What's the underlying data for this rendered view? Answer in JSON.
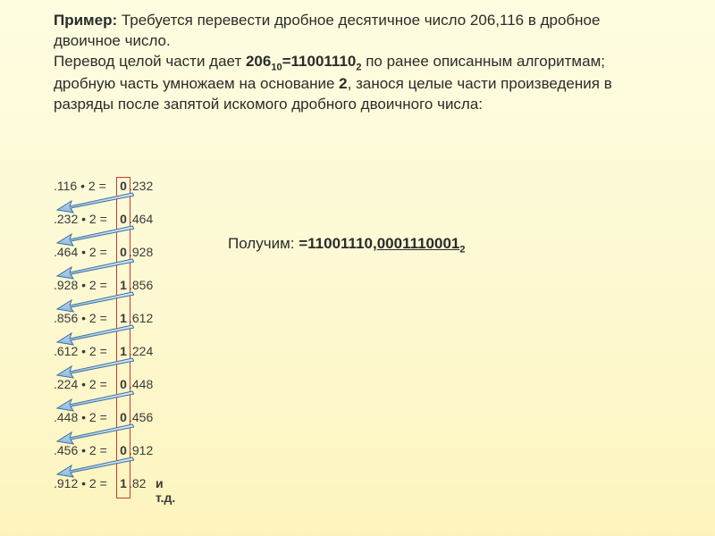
{
  "title": {
    "label_primer": "Пример:",
    "line1_rest": " Требуется перевести дробное десятичное число 206,116 в дробное двоичное число.",
    "line2a": "Перевод целой части дает ",
    "int_dec": "206",
    "int_dec_base": "10",
    "eq": "=",
    "int_bin": "11001110",
    "int_bin_base": "2",
    "line2b": " по ранее описанным алгоритмам; дробную часть умножаем на основание ",
    "base2": "2",
    "line2c": ", занося целые части произведения в разряды после запятой искомого дробного двоичного числа:"
  },
  "calc": [
    {
      "lhs": ".116 • 2 = ",
      "d": "0",
      "rhs": ".232"
    },
    {
      "lhs": ".232 • 2 = ",
      "d": "0",
      "rhs": ".464"
    },
    {
      "lhs": ".464 • 2 = ",
      "d": "0",
      "rhs": ".928"
    },
    {
      "lhs": ".928 • 2 = ",
      "d": "1",
      "rhs": ".856"
    },
    {
      "lhs": ".856 • 2 = ",
      "d": "1",
      "rhs": ".612"
    },
    {
      "lhs": ".612 • 2 = ",
      "d": "1",
      "rhs": ".224"
    },
    {
      "lhs": ".224 • 2 = ",
      "d": "0",
      "rhs": ".448"
    },
    {
      "lhs": ".448 • 2 = ",
      "d": "0",
      "rhs": ".456"
    },
    {
      "lhs": ".456 • 2 = ",
      "d": "0",
      "rhs": ".912"
    },
    {
      "lhs": ".912 • 2 = ",
      "d": "1",
      "rhs": ".82"
    }
  ],
  "etc": "и т.д.",
  "result": {
    "label": "Получим: ",
    "eq": "=",
    "int_part": "11001110,",
    "frac_part": "0001110001",
    "base": "2"
  },
  "colors": {
    "red_box": "#c83a2f",
    "arrow_fill": "#8fb9e0",
    "arrow_stroke": "#3b6fa0"
  }
}
